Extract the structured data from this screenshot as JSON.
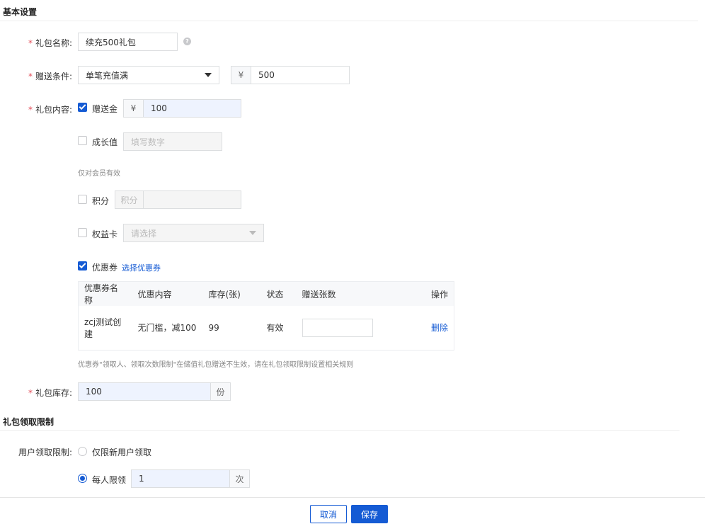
{
  "basic": {
    "section_title": "基本设置",
    "name_label": "礼包名称:",
    "name_value": "续充500礼包",
    "condition_label": "赠送条件:",
    "condition_value": "单笔充值满",
    "condition_currency": "¥",
    "condition_amount": "500",
    "content_label": "礼包内容:",
    "gift_money_label": "赠送金",
    "gift_money_currency": "¥",
    "gift_money_value": "100",
    "growth_label": "成长值",
    "growth_placeholder": "填写数字",
    "member_hint": "仅对会员有效",
    "points_label": "积分",
    "points_prefix": "积分",
    "benefit_label": "权益卡",
    "benefit_placeholder": "请选择",
    "coupon_label": "优惠券",
    "coupon_select_link": "选择优惠券",
    "coupon_table": {
      "headers": [
        "优惠券名称",
        "优惠内容",
        "库存(张)",
        "状态",
        "赠送张数",
        "操作"
      ],
      "rows": [
        {
          "name": "zcj测试创建",
          "content": "无门槛，减100",
          "stock": "99",
          "status": "有效",
          "qty": "",
          "action": "删除"
        }
      ]
    },
    "coupon_hint": "优惠券\"领取人、领取次数限制\"在储值礼包赠送不生效，请在礼包领取限制设置相关规则",
    "stock_label": "礼包库存:",
    "stock_value": "100",
    "stock_unit": "份"
  },
  "limit": {
    "section_title": "礼包领取限制",
    "user_limit_label": "用户领取限制:",
    "new_user_option": "仅限新用户领取",
    "per_user_option": "每人限领",
    "per_user_value": "1",
    "per_user_unit": "次"
  },
  "footer": {
    "cancel_label": "取消",
    "save_label": "保存"
  },
  "colors": {
    "primary": "#155bd4",
    "required": "#e34d59"
  }
}
